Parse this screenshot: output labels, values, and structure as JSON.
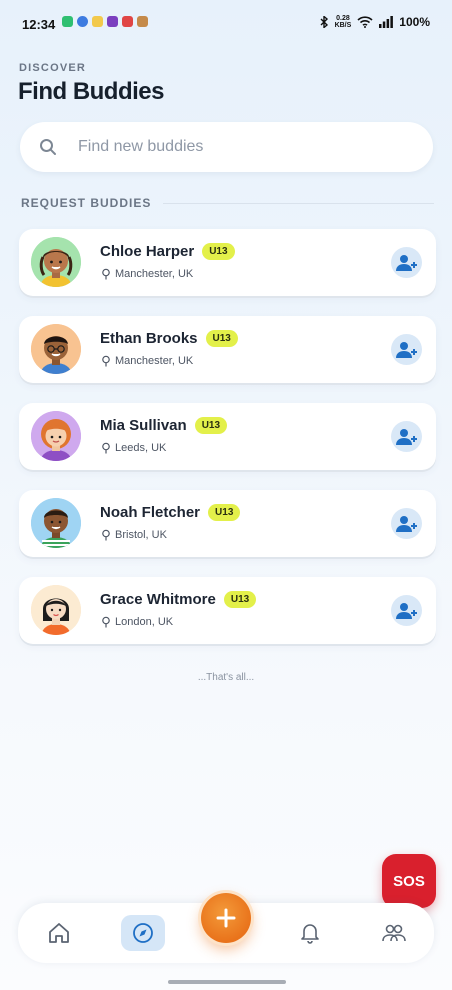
{
  "status_bar": {
    "time": "12:34",
    "net_speed_value": "0.28",
    "net_speed_unit": "KB/S",
    "battery": "100%"
  },
  "header": {
    "eyebrow": "DISCOVER",
    "title": "Find Buddies"
  },
  "search": {
    "placeholder": "Find new buddies"
  },
  "section": {
    "title": "REQUEST BUDDIES"
  },
  "buddies": [
    {
      "name": "Chloe Harper",
      "badge": "U13",
      "location": "Manchester, UK"
    },
    {
      "name": "Ethan Brooks",
      "badge": "U13",
      "location": "Manchester, UK"
    },
    {
      "name": "Mia Sullivan",
      "badge": "U13",
      "location": "Leeds, UK"
    },
    {
      "name": "Noah Fletcher",
      "badge": "U13",
      "location": "Bristol, UK"
    },
    {
      "name": "Grace Whitmore",
      "badge": "U13",
      "location": "London, UK"
    }
  ],
  "footer_note": "...That's all...",
  "sos_label": "SOS",
  "colors": {
    "accent_blue": "#1f6fc5",
    "fab_orange": "#e9731b",
    "sos_red": "#d9202d",
    "badge_yellow": "#e3f04a"
  },
  "nav": {
    "items": [
      "home-icon",
      "compass-icon",
      "add-icon",
      "bell-icon",
      "friends-icon"
    ],
    "active": "compass-icon"
  }
}
